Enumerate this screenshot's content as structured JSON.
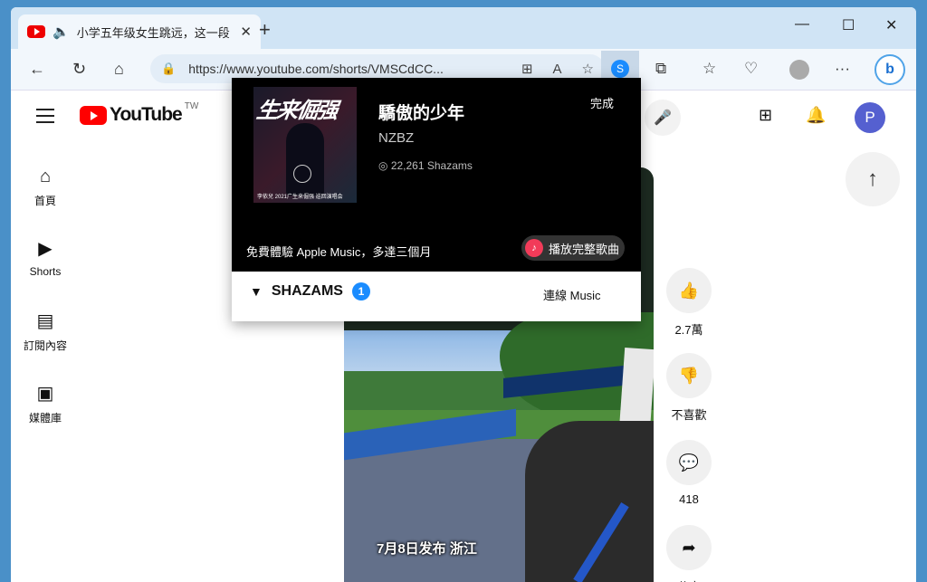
{
  "browser": {
    "tab_title": "小学五年级女生跳远，这一段",
    "url": "https://www.youtube.com/shorts/VMSCdCC...",
    "close_glyph": "✕",
    "newtab_glyph": "+"
  },
  "youtube": {
    "logo_word": "YouTube",
    "country": "TW",
    "avatar_letter": "P",
    "sidebar": [
      {
        "label": "首頁",
        "icon": "home-icon"
      },
      {
        "label": "Shorts",
        "icon": "shorts-icon"
      },
      {
        "label": "訂閱內容",
        "icon": "subscriptions-icon"
      },
      {
        "label": "媒體庫",
        "icon": "library-icon"
      }
    ],
    "video_caption": "7月8日发布 浙江",
    "actions": {
      "like": "2.7萬",
      "dislike": "不喜歡",
      "comments": "418",
      "share": "分享"
    }
  },
  "shazam": {
    "art_title": "生来倔强",
    "art_subtitle": "李依兒 2021广生来倔强 巡回演唱会",
    "song": "驕傲的少年",
    "artist": "NZBZ",
    "count": "22,261 Shazams",
    "done": "完成",
    "promo": "免費體驗 Apple Music，多達三個月",
    "play_full": "播放完整歌曲",
    "shazams_label": "SHAZAMS",
    "shazams_count": "1",
    "connect": "連線 Music"
  }
}
